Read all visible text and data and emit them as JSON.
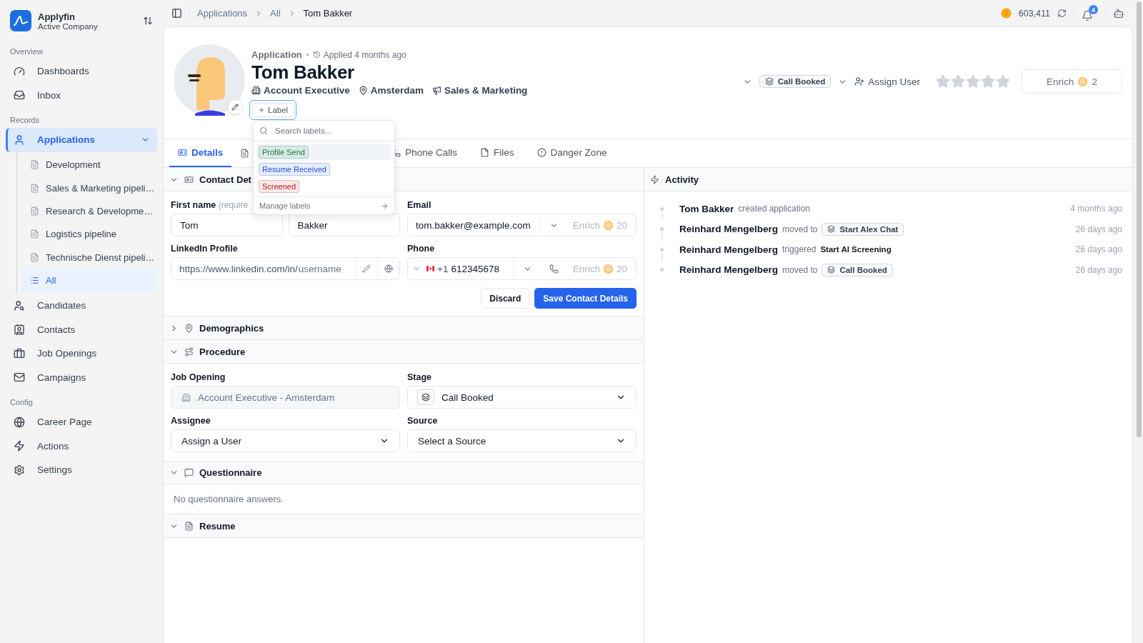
{
  "top_bar": {
    "breadcrumb": [
      "Applications",
      "All",
      "Tom Bakker"
    ],
    "credits": "603,411",
    "notifications": "4"
  },
  "sidebar": {
    "company": "Applyfin",
    "company_subtitle": "Active Company",
    "sections": [
      {
        "title": "Overview",
        "items": [
          {
            "label": "Dashboards",
            "selected": false
          },
          {
            "label": "Inbox",
            "selected": false
          }
        ]
      },
      {
        "title": "Records",
        "items": [
          {
            "label": "Applications",
            "selected": true,
            "expanded": true,
            "children": [
              {
                "label": "Development",
                "kind": "pipeline",
                "selected": false
              },
              {
                "label": "Sales & Marketing pipeli…",
                "kind": "pipeline",
                "selected": false
              },
              {
                "label": "Research & Developme…",
                "kind": "pipeline",
                "selected": false
              },
              {
                "label": "Logistics pipeline",
                "kind": "pipeline",
                "selected": false
              },
              {
                "label": "Technische Dienst pipeli…",
                "kind": "pipeline",
                "selected": false
              },
              {
                "label": "All",
                "kind": "list",
                "selected": true
              }
            ]
          },
          {
            "label": "Candidates",
            "selected": false
          },
          {
            "label": "Contacts",
            "selected": false
          },
          {
            "label": "Job Openings",
            "selected": false
          },
          {
            "label": "Campaigns",
            "selected": false
          }
        ]
      },
      {
        "title": "Config",
        "items": [
          {
            "label": "Career Page",
            "selected": false
          },
          {
            "label": "Actions",
            "selected": false
          },
          {
            "label": "Settings",
            "selected": false
          }
        ]
      }
    ]
  },
  "header": {
    "record_type": "Application",
    "applied": "Applied 4 months ago",
    "name": "Tom Bakker",
    "facts": [
      "Account Executive",
      "Amsterdam",
      "Sales & Marketing"
    ],
    "label_button": "Label",
    "stage": "Call Booked",
    "assign": "Assign User",
    "stars": 0,
    "enrich": {
      "label": "Enrich",
      "cost": "2",
      "disabled": false
    }
  },
  "label_menu": {
    "placeholder": "Search labels...",
    "labels": [
      {
        "label": "Profile Send",
        "color": "#15803d",
        "selected": true
      },
      {
        "label": "Resume Received",
        "color": "#1d4ed8",
        "selected": false
      },
      {
        "label": "Screened",
        "color": "#b91c1c",
        "selected": false
      }
    ],
    "footer": "Manage labels"
  },
  "tabs": [
    {
      "kind": "tab",
      "label": "Details",
      "selected": true
    },
    {
      "kind": "covered"
    },
    {
      "kind": "tab",
      "label": "Phone Calls",
      "selected": false
    },
    {
      "kind": "tab",
      "label": "Files",
      "selected": false
    },
    {
      "kind": "tab",
      "label": "Danger Zone",
      "selected": false
    }
  ],
  "contact_details": {
    "title": "Contact Det",
    "expanded": true,
    "first_name": {
      "label": "First name",
      "hint": "(require",
      "value": "Tom"
    },
    "last_name": {
      "value": "Bakker"
    },
    "email": {
      "label": "Email",
      "value": "tom.bakker@example.com",
      "enrich": "Enrich",
      "cost": "20",
      "disabled": true
    },
    "linkedin": {
      "label": "LinkedIn Profile",
      "prefix": "https://www.linkedin.com/in/",
      "placeholder": "username"
    },
    "phone": {
      "label": "Phone",
      "code": "+1",
      "value": "612345678",
      "enrich": "Enrich",
      "cost": "20",
      "disabled": true
    },
    "buttons": [
      "Discard",
      "Save Contact Details"
    ]
  },
  "demographics": {
    "title": "Demographics",
    "expanded": false
  },
  "procedure": {
    "title": "Procedure",
    "expanded": true,
    "job_opening": {
      "label": "Job Opening",
      "value": "Account Executive - Amsterdam",
      "disabled": true
    },
    "stage": {
      "label": "Stage",
      "value": "Call Booked"
    },
    "assignee": {
      "label": "Assignee",
      "value": "Assign a User"
    },
    "source": {
      "label": "Source",
      "value": "Select a Source"
    }
  },
  "questionnaire": {
    "title": "Questionnaire",
    "expanded": true,
    "empty": "No questionnaire answers."
  },
  "resume": {
    "title": "Resume",
    "expanded": true
  },
  "activity": {
    "title": "Activity",
    "events": [
      {
        "actor": "Tom Bakker",
        "action": "created application",
        "time": "4 months ago"
      },
      {
        "actor": "Reinhard Mengelberg",
        "action": "moved to",
        "target": {
          "kind": "stage",
          "label": "Start Alex Chat"
        },
        "time": "26 days ago"
      },
      {
        "actor": "Reinhard Mengelberg",
        "action": "triggered",
        "target": {
          "kind": "action",
          "label": "Start AI Screening"
        },
        "time": "26 days ago"
      },
      {
        "actor": "Reinhard Mengelberg",
        "action": "moved to",
        "target": {
          "kind": "stage",
          "label": "Call Booked"
        },
        "time": "26 days ago"
      }
    ]
  }
}
